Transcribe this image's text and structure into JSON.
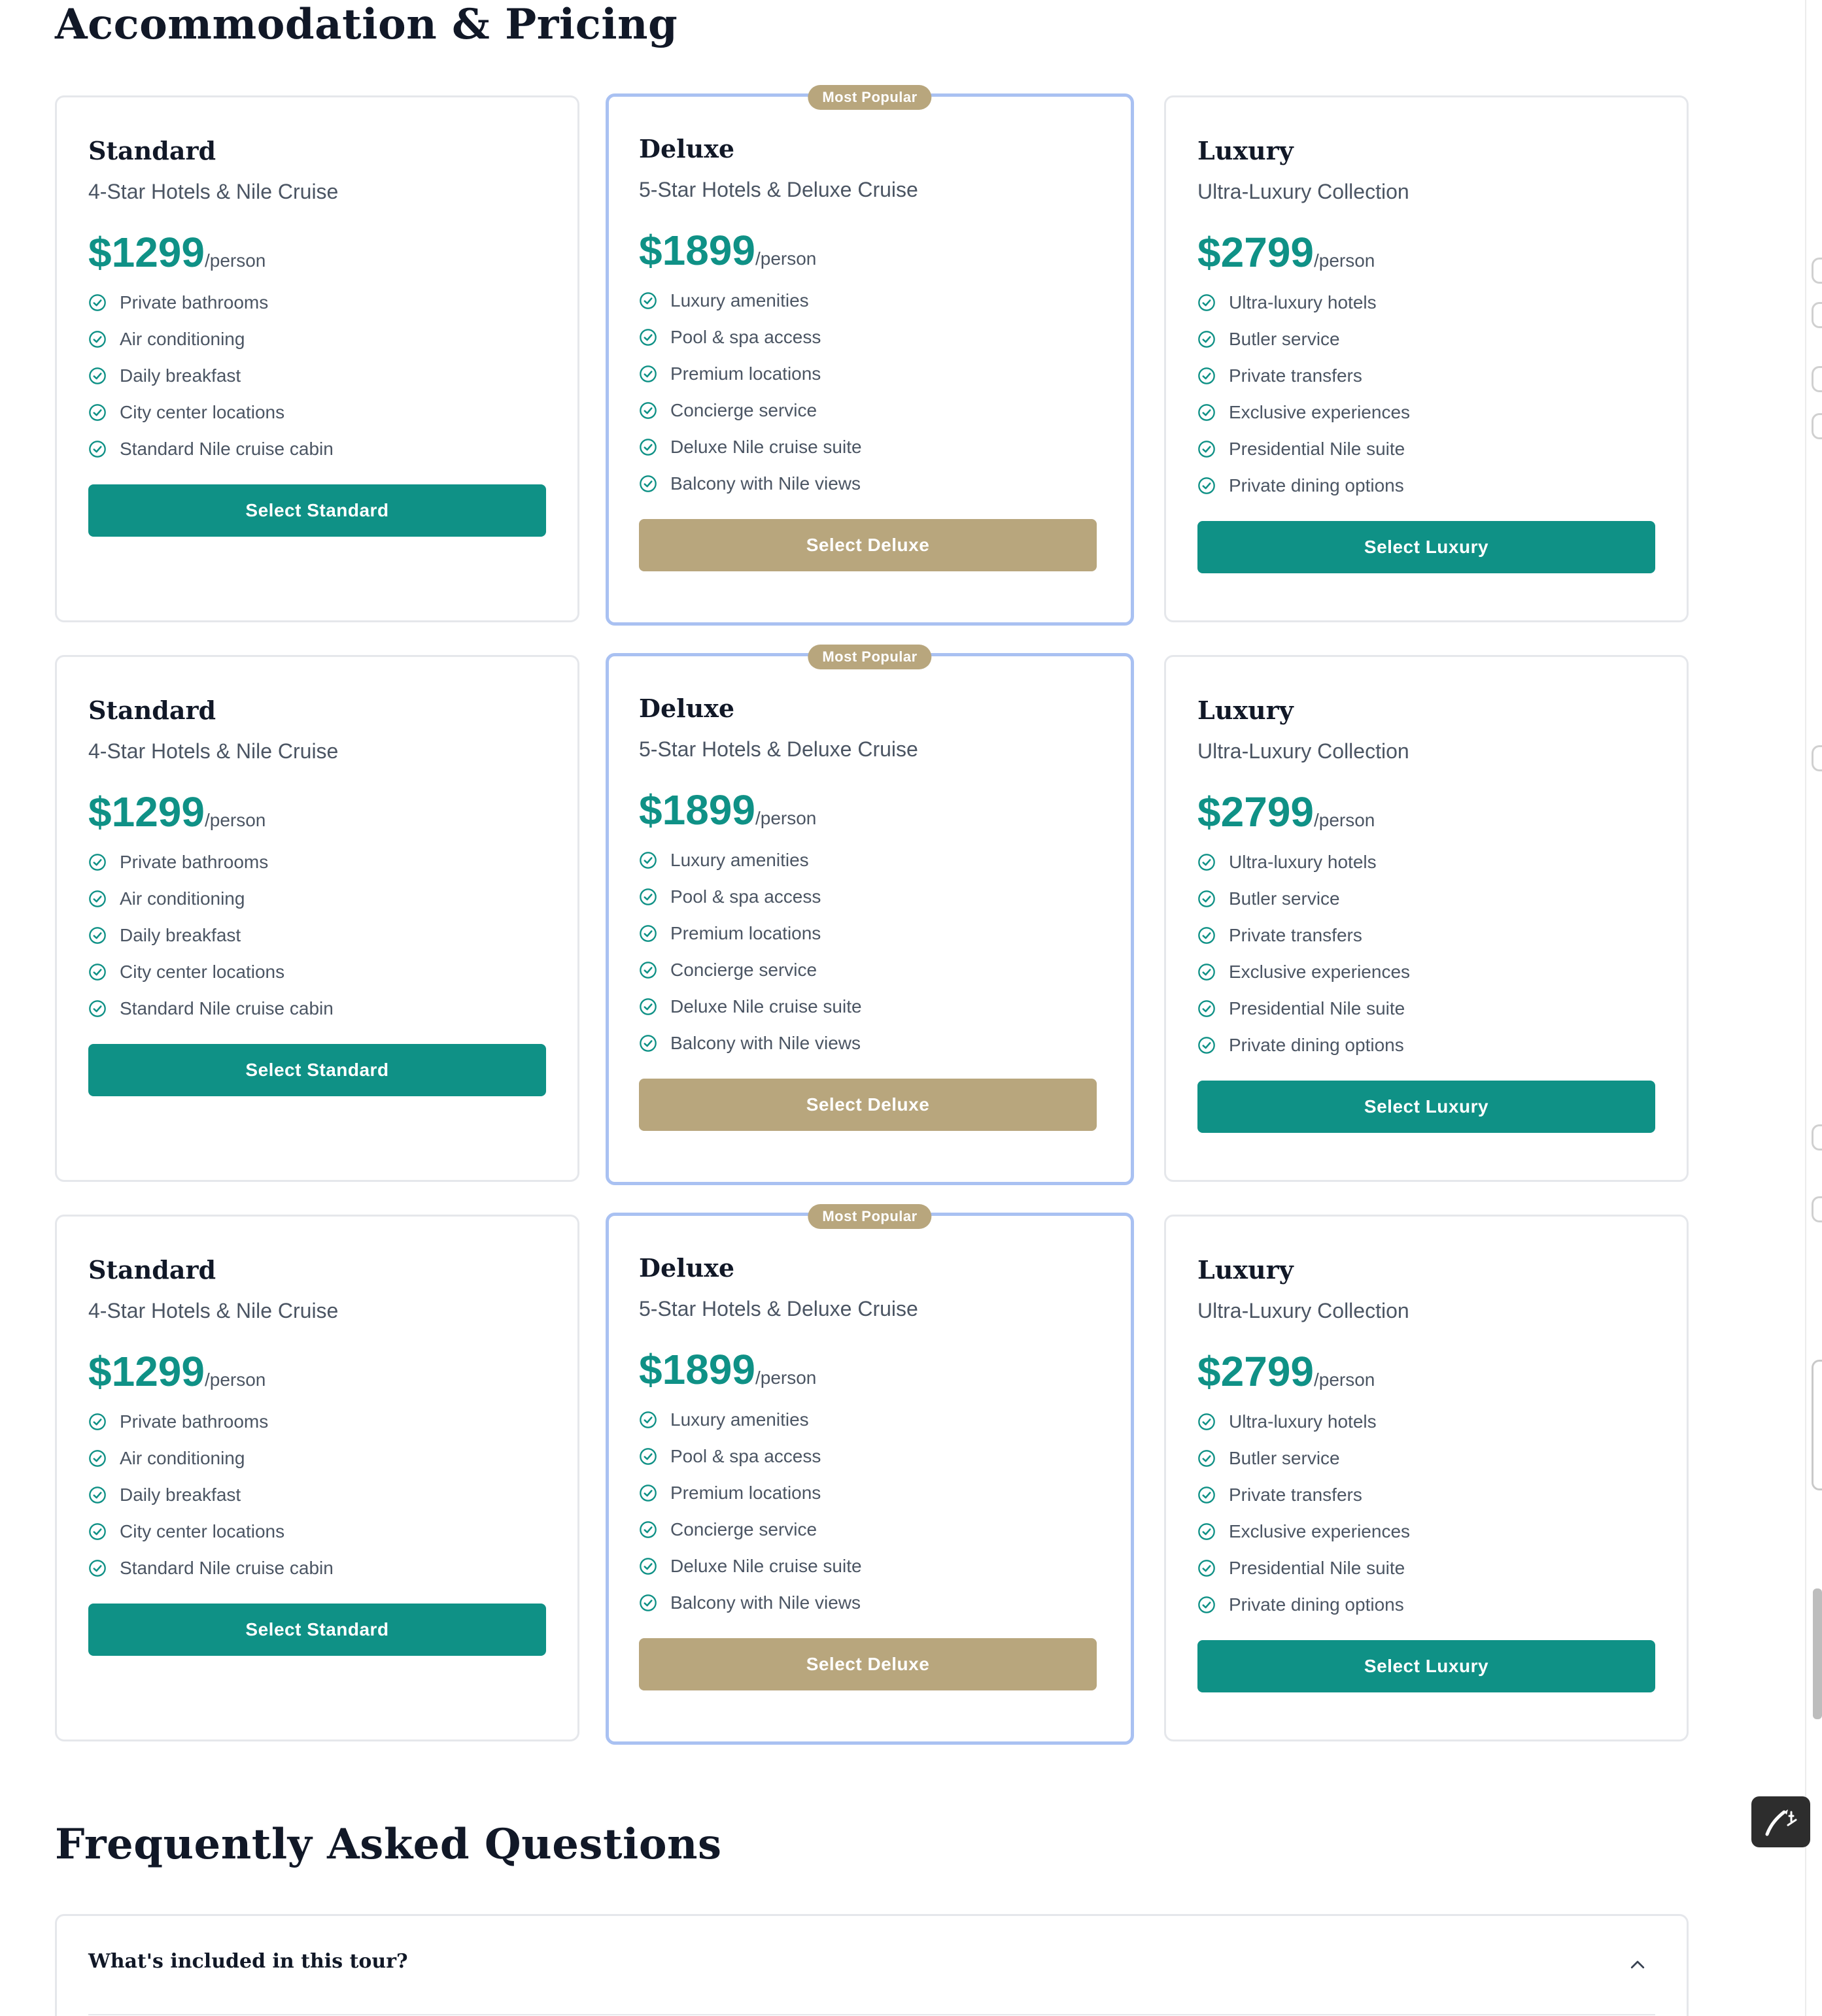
{
  "pricing_section": {
    "title": "Accommodation & Pricing",
    "badge_label": "Most Popular",
    "tiers": [
      {
        "name": "Standard",
        "subtitle": "4-Star Hotels & Nile Cruise",
        "price": "$1299",
        "unit": "/person",
        "features": [
          "Private bathrooms",
          "Air conditioning",
          "Daily breakfast",
          "City center locations",
          "Standard Nile cruise cabin"
        ],
        "button_label": "Select Standard"
      },
      {
        "name": "Deluxe",
        "subtitle": "5-Star Hotels & Deluxe Cruise",
        "price": "$1899",
        "unit": "/person",
        "features": [
          "Luxury amenities",
          "Pool & spa access",
          "Premium locations",
          "Concierge service",
          "Deluxe Nile cruise suite",
          "Balcony with Nile views"
        ],
        "button_label": "Select Deluxe"
      },
      {
        "name": "Luxury",
        "subtitle": "Ultra-Luxury Collection",
        "price": "$2799",
        "unit": "/person",
        "features": [
          "Ultra-luxury hotels",
          "Butler service",
          "Private transfers",
          "Exclusive experiences",
          "Presidential Nile suite",
          "Private dining options"
        ],
        "button_label": "Select Luxury"
      }
    ]
  },
  "faq_section": {
    "title": "Frequently Asked Questions",
    "items": [
      {
        "question": "What's included in this tour?",
        "icon": "chevron-up-icon"
      }
    ]
  },
  "colors": {
    "accent_teal": "#0f9186",
    "accent_gold": "#b8a67d",
    "popular_border": "#a9c1f2"
  },
  "icons": {
    "feature": "check-circle-icon",
    "faq_toggle": "chevron-up-icon"
  }
}
